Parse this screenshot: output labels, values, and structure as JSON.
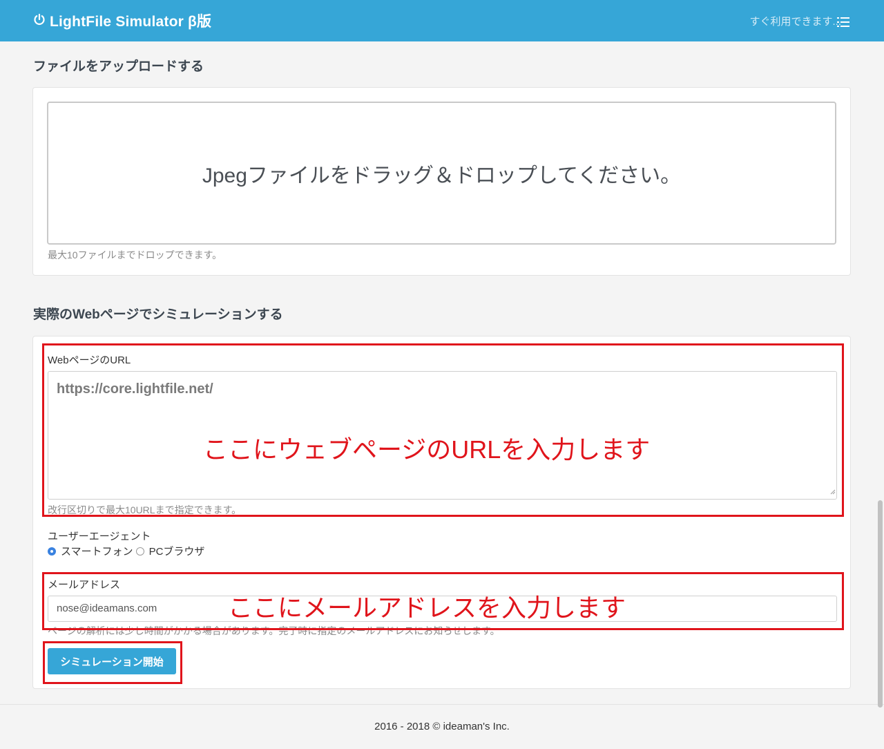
{
  "navbar": {
    "brand_icon": "power-icon",
    "title": "LightFile Simulator β版",
    "right_text": "すぐ利用できます...",
    "menu_icon": "list-icon",
    "color": "#36a6d7"
  },
  "upload": {
    "heading": "ファイルをアップロードする",
    "dropzone_text": "Jpegファイルをドラッグ＆ドロップしてください。",
    "help": "最大10ファイルまでドロップできます。"
  },
  "simulate": {
    "heading": "実際のWebページでシミュレーションする",
    "url_label": "WebページのURL",
    "url_placeholder": "https://core.lightfile.net/",
    "url_help": "改行区切りで最大10URLまで指定できます。",
    "ua_label": "ユーザーエージェント",
    "ua_options": [
      {
        "label": "スマートフォン",
        "selected": true
      },
      {
        "label": "PCブラウザ",
        "selected": false
      }
    ],
    "email_label": "メールアドレス",
    "email_value": "nose@ideamans.com",
    "email_help": "ページの解析には少し時間がかかる場合があります。完了時に指定のメールアドレスにお知らせします。",
    "start_button": "シミュレーション開始"
  },
  "annotations": {
    "url_note": "ここにウェブページのURLを入力します",
    "email_note": "ここにメールアドレスを入力します",
    "color": "#e0141b"
  },
  "footer": {
    "copyright": "2016 - 2018 © ideaman's Inc."
  }
}
